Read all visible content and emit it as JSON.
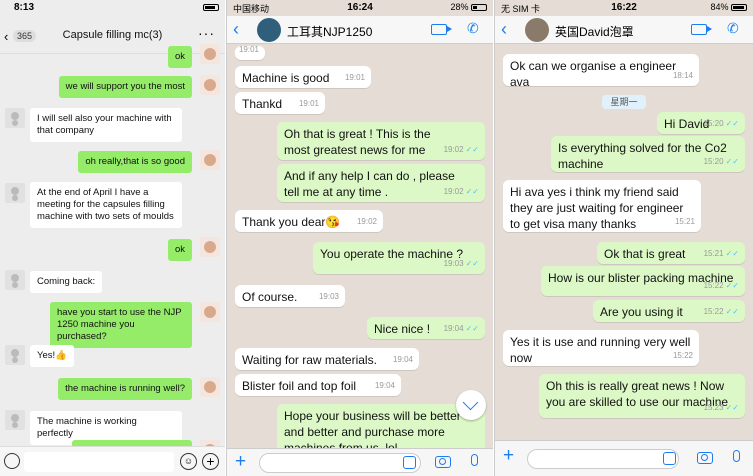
{
  "wechat": {
    "status_time": "8:13",
    "back_badge": "365",
    "title": "Capsule filling mc(3)",
    "messages": [
      {
        "dir": "out",
        "text": "ok"
      },
      {
        "dir": "out",
        "text": "we will support you the most"
      },
      {
        "dir": "in",
        "text": "I will sell also your machine with that company"
      },
      {
        "dir": "out",
        "text": "oh really,that is so good"
      },
      {
        "dir": "in",
        "text": "At the end of April I have a meeting for the capsules filling machine with two sets of moulds"
      },
      {
        "dir": "out",
        "text": "ok"
      },
      {
        "dir": "in",
        "text": "Coming back:"
      },
      {
        "dir": "out",
        "text": "have you start to use the NJP 1250 machine you purchased?"
      },
      {
        "dir": "in",
        "text": "Yes!👍"
      },
      {
        "dir": "out",
        "text": "the machine is running well?"
      },
      {
        "dir": "in",
        "text": "The machine is working perfectly"
      }
    ]
  },
  "wa1": {
    "carrier": "中国移动",
    "status_time": "16:24",
    "battery": "28%",
    "contact_name": "工耳其NJP1250",
    "messages": [
      {
        "dir": "in",
        "text": "Machine is good",
        "time": "19:01"
      },
      {
        "dir": "in",
        "text": "Thankd",
        "time": "19:01"
      },
      {
        "dir": "out",
        "text": "Oh that is great ! This is the most greatest news for me",
        "time": "19:02"
      },
      {
        "dir": "out",
        "text": "And if any help I can do , please tell me at any time .",
        "time": "19:02"
      },
      {
        "dir": "in",
        "text": "Thank you dear😘",
        "time": "19:02"
      },
      {
        "dir": "out",
        "text": "You operate the machine ?",
        "time": "19:03"
      },
      {
        "dir": "in",
        "text": "Of course.",
        "time": "19:03"
      },
      {
        "dir": "out",
        "text": "Nice nice !",
        "time": "19:04"
      },
      {
        "dir": "in",
        "text": "Waiting for raw materials.",
        "time": "19:04"
      },
      {
        "dir": "in",
        "text": "Blister foil and top foil",
        "time": "19:04"
      },
      {
        "dir": "out",
        "text": "Hope your business will be better and better and purchase more machines from us ,lol",
        "time": ""
      }
    ]
  },
  "wa2": {
    "carrier": "无 SIM 卡",
    "status_time": "16:22",
    "battery": "84%",
    "contact_name": "英国David泡罩",
    "date_divider": "星期一",
    "messages": [
      {
        "dir": "in",
        "text": "Ok can we organise a engineer ava",
        "time": "18:14"
      },
      {
        "dir": "out",
        "text": "Hi David",
        "time": "15:20"
      },
      {
        "dir": "out",
        "text": "Is everything solved for the Co2 machine",
        "time": "15:20"
      },
      {
        "dir": "in",
        "text": "Hi ava yes i think my friend said they are just waiting for engineer to get visa many thanks",
        "time": "15:21"
      },
      {
        "dir": "out",
        "text": "Ok that is great",
        "time": "15:21"
      },
      {
        "dir": "out",
        "text": "How is our blister packing machine",
        "time": "15:22"
      },
      {
        "dir": "out",
        "text": "Are you using it",
        "time": "15:22"
      },
      {
        "dir": "in",
        "text": "Yes it is use and running very well now",
        "time": "15:22"
      },
      {
        "dir": "out",
        "text": "Oh this is really great news ! Now you are skilled to use our machine",
        "time": "15:23"
      }
    ]
  },
  "colors": {
    "wechat_bg": "#ededed",
    "wechat_out": "#95ec69",
    "whatsapp_bg": "#e5ddd5",
    "whatsapp_out": "#dcf8c6",
    "whatsapp_accent": "#1a7ef2"
  }
}
